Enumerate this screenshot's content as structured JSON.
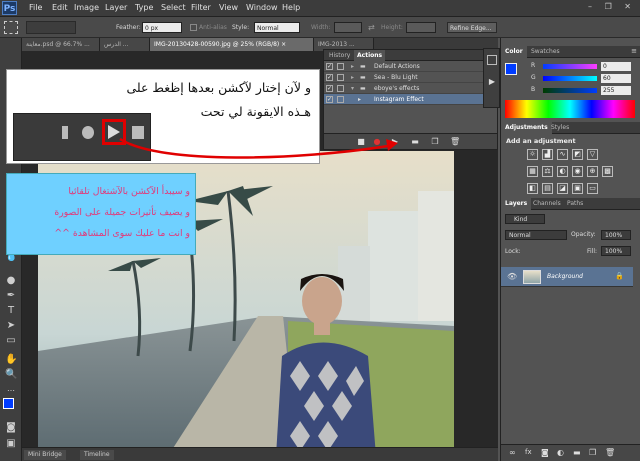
{
  "app": {
    "logo": "Ps"
  },
  "menu": [
    "File",
    "Edit",
    "Image",
    "Layer",
    "Type",
    "Select",
    "Filter",
    "View",
    "Window",
    "Help"
  ],
  "window_controls": "– ❐ ✕",
  "options": {
    "feather_label": "Feather:",
    "feather_value": "0 px",
    "antialias_label": "Anti-alias",
    "style_label": "Style:",
    "style_value": "Normal",
    "width_label": "Width:",
    "height_label": "Height:",
    "refine_label": "Refine Edge..."
  },
  "doc_tabs": [
    {
      "label": "معاينة.psd @ 66.7% ..."
    },
    {
      "label": "الدرس ..."
    },
    {
      "label": "IMG-20130428-00590.jpg @ 25% (RGB/8) ×"
    },
    {
      "label": "IMG-2013 ..."
    }
  ],
  "actions_panel": {
    "tab_history": "History",
    "tab_actions": "Actions",
    "rows": [
      {
        "label": "Default Actions",
        "level": 0
      },
      {
        "label": "Sea - Blu Light",
        "level": 0
      },
      {
        "label": "eboye's effects",
        "level": 0
      },
      {
        "label": "Instagram Effect",
        "level": 1
      }
    ]
  },
  "color_panel": {
    "tab_color": "Color",
    "tab_swatches": "Swatches",
    "r": "0",
    "g": "60",
    "b": "255",
    "fg_color": "#003cff"
  },
  "adjustments_panel": {
    "tab_adjustments": "Adjustments",
    "tab_styles": "Styles",
    "subtitle": "Add an adjustment"
  },
  "layers_panel": {
    "tab_layers": "Layers",
    "tab_channels": "Channels",
    "tab_paths": "Paths",
    "kind": "Kind",
    "blend": "Normal",
    "opacity_label": "Opacity:",
    "opacity_value": "100%",
    "lock_label": "Lock:",
    "fill_label": "Fill:",
    "fill_value": "100%",
    "layer_name": "Background"
  },
  "status_tabs": {
    "mini_bridge": "Mini Bridge",
    "timeline": "Timeline"
  },
  "tutorial": {
    "line1": "و لآن إختار لآكشن بعدها إظغط على",
    "line2": "هـذه الايقونة لي تحت",
    "line3": "و سيبدأ الآكشن بالآشتغال تلقائيا",
    "line4": "و يضيف تأثيرات جميلة على الصورة",
    "line5": "و انت ما عليك سوى المشاهدة ^^"
  }
}
